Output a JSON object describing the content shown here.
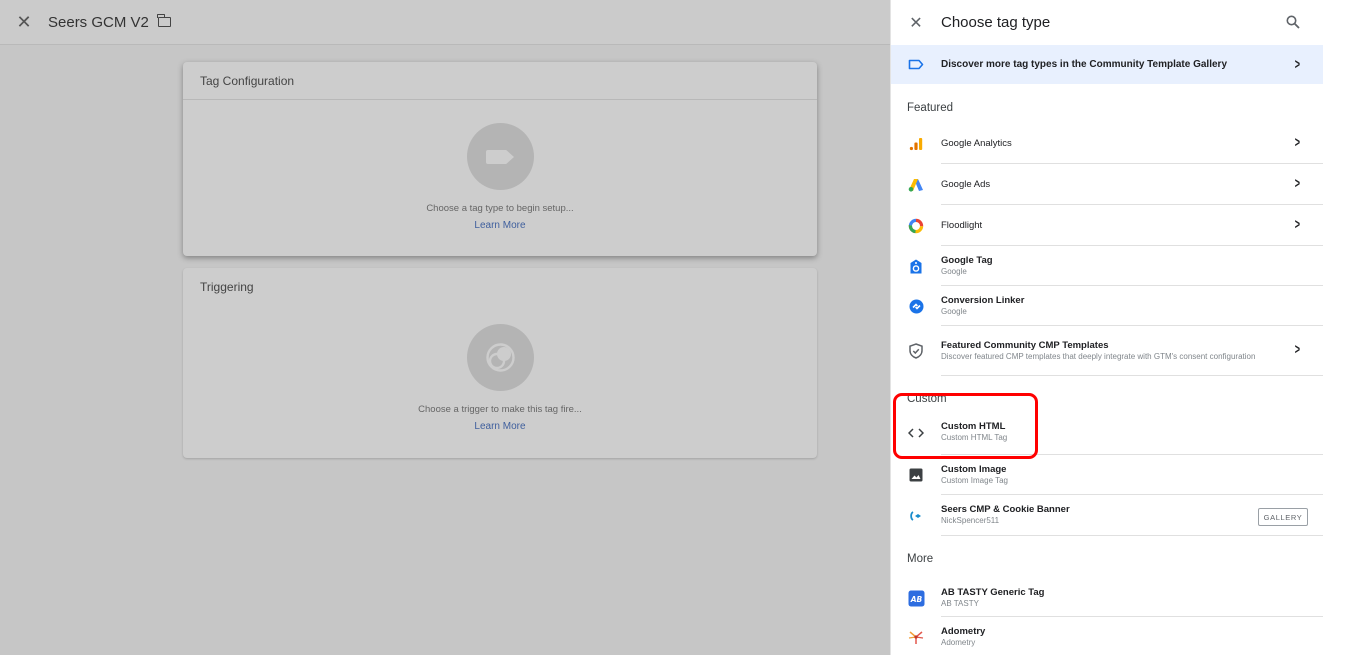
{
  "header": {
    "title": "Seers GCM V2"
  },
  "tag_configuration": {
    "title": "Tag Configuration",
    "message": "Choose a tag type to begin setup...",
    "learn_more": "Learn More"
  },
  "triggering": {
    "title": "Triggering",
    "message": "Choose a trigger to make this tag fire...",
    "learn_more": "Learn More"
  },
  "panel": {
    "title": "Choose tag type",
    "discover": "Discover more tag types in the Community Template Gallery",
    "sections": {
      "featured": "Featured",
      "custom": "Custom",
      "more": "More"
    },
    "featured_items": [
      {
        "title": "Google Analytics",
        "icon": "google-analytics-icon"
      },
      {
        "title": "Google Ads",
        "icon": "google-ads-icon"
      },
      {
        "title": "Floodlight",
        "icon": "floodlight-icon"
      },
      {
        "title": "Google Tag",
        "subtitle": "Google",
        "icon": "google-tag-icon"
      },
      {
        "title": "Conversion Linker",
        "subtitle": "Google",
        "icon": "conversion-linker-icon"
      },
      {
        "title": "Featured Community CMP Templates",
        "subtitle": "Discover featured CMP templates that deeply integrate with GTM's consent configuration",
        "icon": "shield-check-icon"
      }
    ],
    "custom_items": [
      {
        "title": "Custom HTML",
        "subtitle": "Custom HTML Tag",
        "icon": "code-icon"
      },
      {
        "title": "Custom Image",
        "subtitle": "Custom Image Tag",
        "icon": "image-icon"
      },
      {
        "title": "Seers CMP & Cookie Banner",
        "subtitle": "NickSpencer511",
        "icon": "seers-icon",
        "badge": "GALLERY"
      }
    ],
    "more_items": [
      {
        "title": "AB TASTY Generic Tag",
        "subtitle": "AB TASTY",
        "icon": "ab-tasty-icon"
      },
      {
        "title": "Adometry",
        "subtitle": "Adometry",
        "icon": "adometry-icon"
      }
    ]
  },
  "colors": {
    "highlight": "#ff0000",
    "discover_bg": "#e8f0fe",
    "overlay": "#c6c6c6"
  }
}
